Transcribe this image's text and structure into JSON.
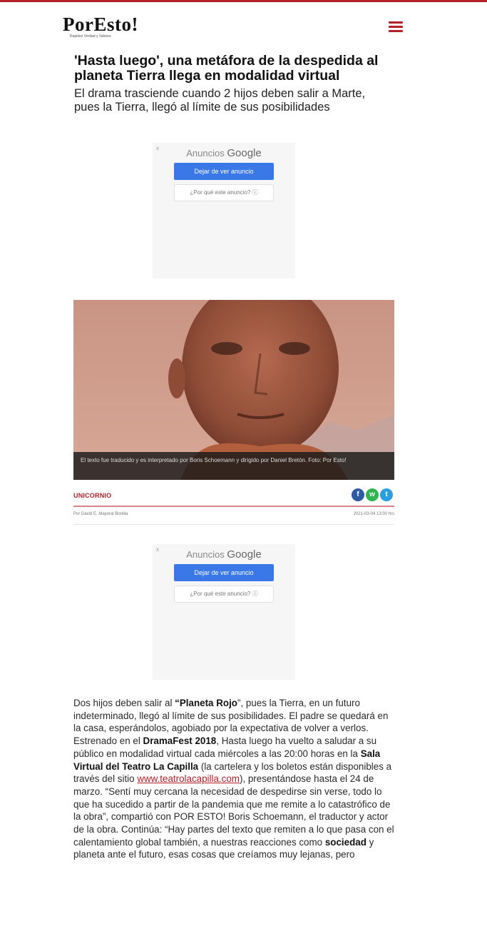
{
  "header": {
    "logo": "PorEsto!",
    "logo_tagline": "Rapidez Verdad y Valores",
    "menu_icon": "hamburger-menu-icon"
  },
  "article": {
    "headline": "'Hasta luego', una metáfora de la despedida al planeta Tierra llega en modalidad virtual",
    "subheadline": "El drama trasciende cuando 2 hijos deben salir a Marte, pues la Tierra, llegó al límite de sus posibilidades",
    "image_caption": "El texto fue traducido y es interpretado por Boris Schoemann y dirigido por Daniel Bretón. Foto: Por Esto!",
    "section": "UNICORNIO",
    "byline": "Por David E. Mayoral Bonilla",
    "date": "2021-03-04 13:00 hrs",
    "share_icons": [
      "facebook-icon",
      "whatsapp-icon",
      "twitter-icon"
    ],
    "body": {
      "p1": "Dos hijos deben salir al ",
      "b1": "“Planeta Rojo",
      "p2": "”, pues la Tierra, en un futuro indeterminado, llegó al límite de sus posibilidades. El padre se quedará en la casa, esperándolos, agobiado por la expectativa de volver a verlos. Estrenado en el ",
      "b2": "DramaFest 2018",
      "p3": ", Hasta luego ha vuelto a saludar a su público en modalidad virtual cada miércoles a las 20:00 horas en la ",
      "b3": "Sala Virtual del Teatro La Capilla",
      "p4": " (la cartelera y los boletos están disponibles a través del sitio ",
      "link": "www.teatrolacapilla.com",
      "p5": "), presentándose hasta el 24 de marzo. “Sentí muy cercana la necesidad de despedirse sin verse, todo lo que ha sucedido a partir de la pandemia que me remite a lo catastrófico de la obra”, compartió con POR ESTO! Boris Schoemann, el traductor y actor de la obra. Continúa: “Hay partes del texto que remiten a lo que pasa con el calentamiento global también, a nuestras reacciones como ",
      "b4": "sociedad",
      "p6": " y planeta ante el futuro, esas cosas que creíamos muy lejanas, pero"
    }
  },
  "ads": {
    "label_prefix": "Anuncios",
    "label_brand": "Google",
    "close_glyph": "x",
    "stop_button": "Dejar de ver anuncio",
    "why_button": "¿Por qué este anuncio? ⓘ"
  },
  "colors": {
    "brand_red": "#b3202a",
    "facebook": "#2d5aa0",
    "whatsapp": "#2fb450",
    "twitter": "#2a9fe0",
    "ad_button": "#3b78e7"
  }
}
